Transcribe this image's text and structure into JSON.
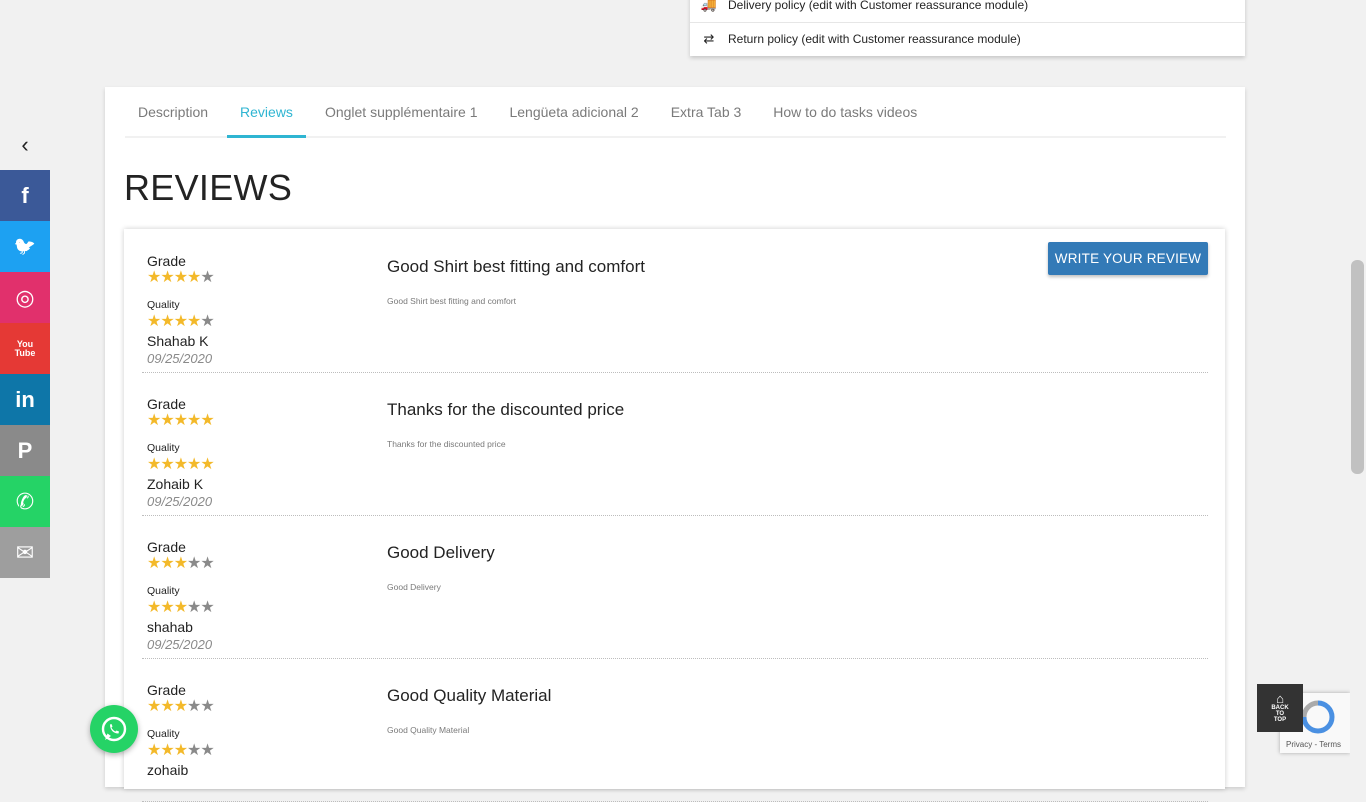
{
  "reassurance": {
    "delivery": "Delivery policy (edit with Customer reassurance module)",
    "return": "Return policy (edit with Customer reassurance module)"
  },
  "social": {
    "collapse_glyph": "‹",
    "items": [
      {
        "name": "facebook",
        "glyph": "f",
        "color": "#3b5998"
      },
      {
        "name": "twitter",
        "glyph": "🐦",
        "color": "#1da1f2"
      },
      {
        "name": "instagram",
        "glyph": "◎",
        "color": "#e1306c"
      },
      {
        "name": "youtube",
        "glyph": "You\nTube",
        "color": "#e53935"
      },
      {
        "name": "linkedin",
        "glyph": "in",
        "color": "#0e76a8"
      },
      {
        "name": "pinterest",
        "glyph": "P",
        "color": "#8a8a8a"
      },
      {
        "name": "whatsapp",
        "glyph": "✆",
        "color": "#25d366"
      },
      {
        "name": "email",
        "glyph": "✉",
        "color": "#9e9e9e"
      }
    ]
  },
  "tabs": [
    {
      "label": "Description",
      "active": false
    },
    {
      "label": "Reviews",
      "active": true
    },
    {
      "label": "Onglet supplémentaire 1",
      "active": false
    },
    {
      "label": "Lengüeta adicional 2",
      "active": false
    },
    {
      "label": "Extra Tab 3",
      "active": false
    },
    {
      "label": "How to do tasks videos",
      "active": false
    }
  ],
  "reviews_heading": "REVIEWS",
  "write_review_label": "WRITE YOUR REVIEW",
  "labels": {
    "grade": "Grade",
    "quality": "Quality"
  },
  "reviews": [
    {
      "grade": 4,
      "quality": 4,
      "author": "Shahab K",
      "date": "09/25/2020",
      "title": "Good Shirt best fitting and comfort",
      "body": "Good Shirt best fitting and comfort"
    },
    {
      "grade": 5,
      "quality": 5,
      "author": "Zohaib K",
      "date": "09/25/2020",
      "title": "Thanks for the discounted price",
      "body": "Thanks for the discounted price"
    },
    {
      "grade": 3,
      "quality": 3,
      "author": "shahab",
      "date": "09/25/2020",
      "title": "Good Delivery",
      "body": "Good Delivery"
    },
    {
      "grade": 3,
      "quality": 3,
      "author": "zohaib",
      "date": "",
      "title": "Good Quality Material",
      "body": "Good Quality Material"
    }
  ],
  "back_to_top": {
    "line1": "BACK",
    "line2": "TO",
    "line3": "TOP"
  },
  "recaptcha": {
    "privacy": "Privacy",
    "sep": " - ",
    "terms": "Terms"
  },
  "colors": {
    "accent": "#2fb5d2",
    "button": "#337ab7",
    "star_on": "#f3b92a",
    "star_off": "#8a8a8a"
  }
}
